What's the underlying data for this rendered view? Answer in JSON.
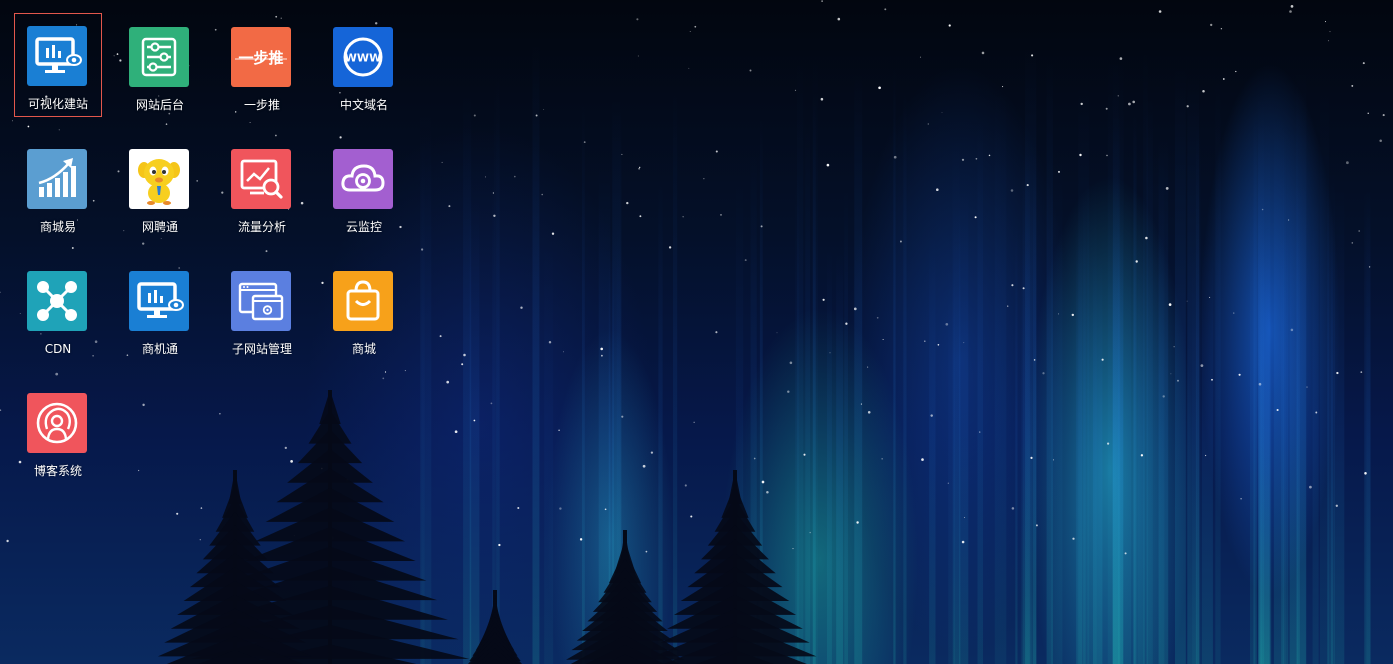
{
  "desktop": {
    "wallpaper": "night-sky-aurora-trees",
    "colors": {
      "selection_border": "#e2574c",
      "label_text": "#ffffff"
    }
  },
  "apps": [
    {
      "label": "可视化建站",
      "icon": "monitor-chart-eye-icon",
      "color": "#1a7fd4",
      "selected": true
    },
    {
      "label": "网站后台",
      "icon": "sliders-icon",
      "color": "#2fb07a",
      "selected": false
    },
    {
      "label": "一步推",
      "icon": "yibutui-logo-icon",
      "color": "#f26a45",
      "selected": false,
      "icon_text": "一步推"
    },
    {
      "label": "中文域名",
      "icon": "www-globe-icon",
      "color": "#1565d8",
      "selected": false,
      "icon_text": "WWW"
    },
    {
      "label": "商城易",
      "icon": "growth-chart-icon",
      "color": "#5b9ed1",
      "selected": false
    },
    {
      "label": "网聘通",
      "icon": "yellow-mascot-icon",
      "color": "#ffffff",
      "selected": false
    },
    {
      "label": "流量分析",
      "icon": "chart-search-icon",
      "color": "#f0555c",
      "selected": false
    },
    {
      "label": "云监控",
      "icon": "cloud-camera-icon",
      "color": "#a35fd0",
      "selected": false
    },
    {
      "label": "CDN",
      "icon": "network-nodes-icon",
      "color": "#1fa3b8",
      "selected": false
    },
    {
      "label": "商机通",
      "icon": "monitor-chart-eye-icon",
      "color": "#1a7fd4",
      "selected": false
    },
    {
      "label": "子网站管理",
      "icon": "browser-windows-gear-icon",
      "color": "#5b7fe0",
      "selected": false
    },
    {
      "label": "商城",
      "icon": "shopping-bag-icon",
      "color": "#f7a11a",
      "selected": false
    },
    {
      "label": "博客系统",
      "icon": "person-signal-icon",
      "color": "#f0555c",
      "selected": false
    }
  ]
}
